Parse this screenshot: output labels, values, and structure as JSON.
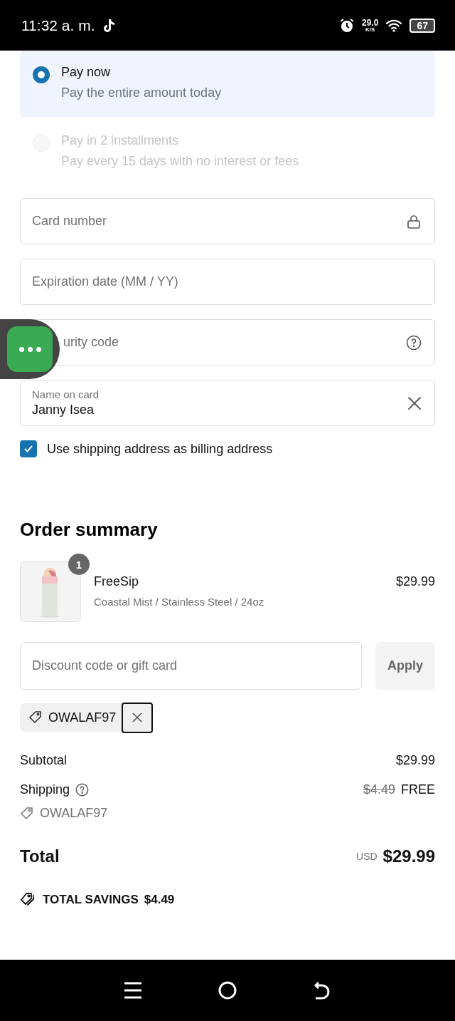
{
  "status_bar": {
    "time": "11:32 a. m.",
    "speed": "29.0",
    "speed_unit": "K/S",
    "battery": "67"
  },
  "payment_options": [
    {
      "title": "Pay now",
      "subtitle": "Pay the entire amount today",
      "selected": true,
      "disabled": false
    },
    {
      "title": "Pay in 2 installments",
      "subtitle": "Pay every 15 days with no interest or fees",
      "selected": false,
      "disabled": true
    }
  ],
  "card_fields": [
    {
      "kind": "lock",
      "placeholder": "Card number"
    },
    {
      "kind": "plain",
      "placeholder": "Expiration date (MM / YY)"
    },
    {
      "kind": "help",
      "placeholder": "urity code"
    },
    {
      "kind": "filled",
      "label": "Name on card",
      "value": "Janny Isea"
    }
  ],
  "billing_checkbox": {
    "label": "Use shipping address as billing address",
    "checked": true
  },
  "order_summary": {
    "title": "Order summary",
    "items": [
      {
        "name": "FreeSip",
        "variant": "Coastal Mist / Stainless Steel / 24oz",
        "price": "$29.99",
        "quantity": "1"
      }
    ],
    "discount": {
      "placeholder": "Discount code or gift card",
      "button": "Apply"
    },
    "applied_codes": [
      {
        "code": "OWALAF97"
      }
    ],
    "subtotal": {
      "label": "Subtotal",
      "value": "$29.99"
    },
    "shipping": {
      "label": "Shipping",
      "old_value": "$4.49",
      "value": "FREE",
      "code": "OWALAF97"
    },
    "total": {
      "label": "Total",
      "currency": "USD",
      "value": "$29.99"
    },
    "savings": {
      "label": "TOTAL SAVINGS",
      "value": "$4.49"
    }
  }
}
